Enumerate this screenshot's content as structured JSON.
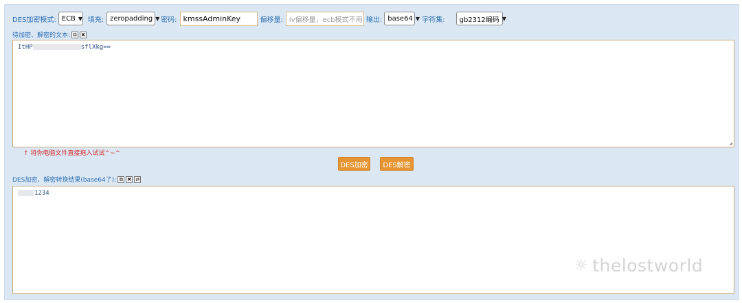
{
  "toolbar": {
    "mode_label": "DES加密模式:",
    "mode_value": "ECB",
    "padding_label": "填充:",
    "padding_value": "zeropadding",
    "password_label": "密码:",
    "password_value": "kmssAdminKey",
    "iv_label": "偏移量:",
    "iv_placeholder": "iv偏移量，ecb模式不用",
    "output_label": "输出:",
    "output_value": "base64",
    "charset_label": "字符集:",
    "charset_value": "gb2312编码"
  },
  "input_section": {
    "label": "待加密、解密的文本:",
    "text_prefix": "ItHP",
    "text_suffix": "sflXkg==",
    "hint": "↑ 将你电脑文件直接拖入试试^~^"
  },
  "actions": {
    "encrypt_label": "DES加密",
    "decrypt_label": "DES解密"
  },
  "output_section": {
    "label": "DES加密、解密转换结果(base64了):",
    "text_suffix": "1234"
  },
  "watermark": {
    "text": "thelostworld"
  }
}
